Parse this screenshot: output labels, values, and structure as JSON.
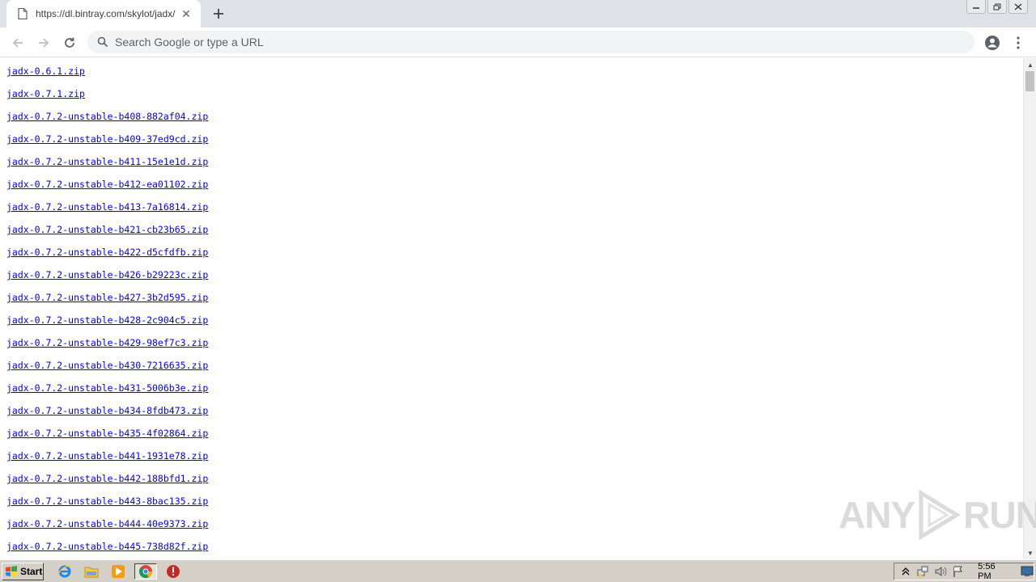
{
  "browser": {
    "tab_title": "https://dl.bintray.com/skylot/jadx/",
    "omnibox_placeholder": "Search Google or type a URL"
  },
  "page": {
    "files": [
      "jadx-0.6.1.zip",
      "jadx-0.7.1.zip",
      "jadx-0.7.2-unstable-b408-882af04.zip",
      "jadx-0.7.2-unstable-b409-37ed9cd.zip",
      "jadx-0.7.2-unstable-b411-15e1e1d.zip",
      "jadx-0.7.2-unstable-b412-ea01102.zip",
      "jadx-0.7.2-unstable-b413-7a16814.zip",
      "jadx-0.7.2-unstable-b421-cb23b65.zip",
      "jadx-0.7.2-unstable-b422-d5cfdfb.zip",
      "jadx-0.7.2-unstable-b426-b29223c.zip",
      "jadx-0.7.2-unstable-b427-3b2d595.zip",
      "jadx-0.7.2-unstable-b428-2c904c5.zip",
      "jadx-0.7.2-unstable-b429-98ef7c3.zip",
      "jadx-0.7.2-unstable-b430-7216635.zip",
      "jadx-0.7.2-unstable-b431-5006b3e.zip",
      "jadx-0.7.2-unstable-b434-8fdb473.zip",
      "jadx-0.7.2-unstable-b435-4f02864.zip",
      "jadx-0.7.2-unstable-b441-1931e78.zip",
      "jadx-0.7.2-unstable-b442-188bfd1.zip",
      "jadx-0.7.2-unstable-b443-8bac135.zip",
      "jadx-0.7.2-unstable-b444-40e9373.zip",
      "jadx-0.7.2-unstable-b445-738d82f.zip"
    ]
  },
  "watermark": {
    "left": "ANY",
    "right": "RUN"
  },
  "taskbar": {
    "start_label": "Start",
    "clock": "5:56 PM"
  },
  "colors": {
    "link": "#0000ee",
    "tabstrip": "#dee1e6",
    "taskbar": "#d4d0c8"
  },
  "icons": [
    "page-icon",
    "close-icon",
    "plus-icon",
    "minimize-icon",
    "restore-icon",
    "window-close-icon",
    "back-icon",
    "forward-icon",
    "reload-icon",
    "search-icon",
    "account-icon",
    "more-vert-icon",
    "windows-logo-icon",
    "ie-icon",
    "folder-icon",
    "media-player-icon",
    "chrome-icon",
    "stop-icon",
    "tray-arrow-icon",
    "network-icon",
    "volume-icon",
    "flag-icon",
    "desktop-icon"
  ]
}
